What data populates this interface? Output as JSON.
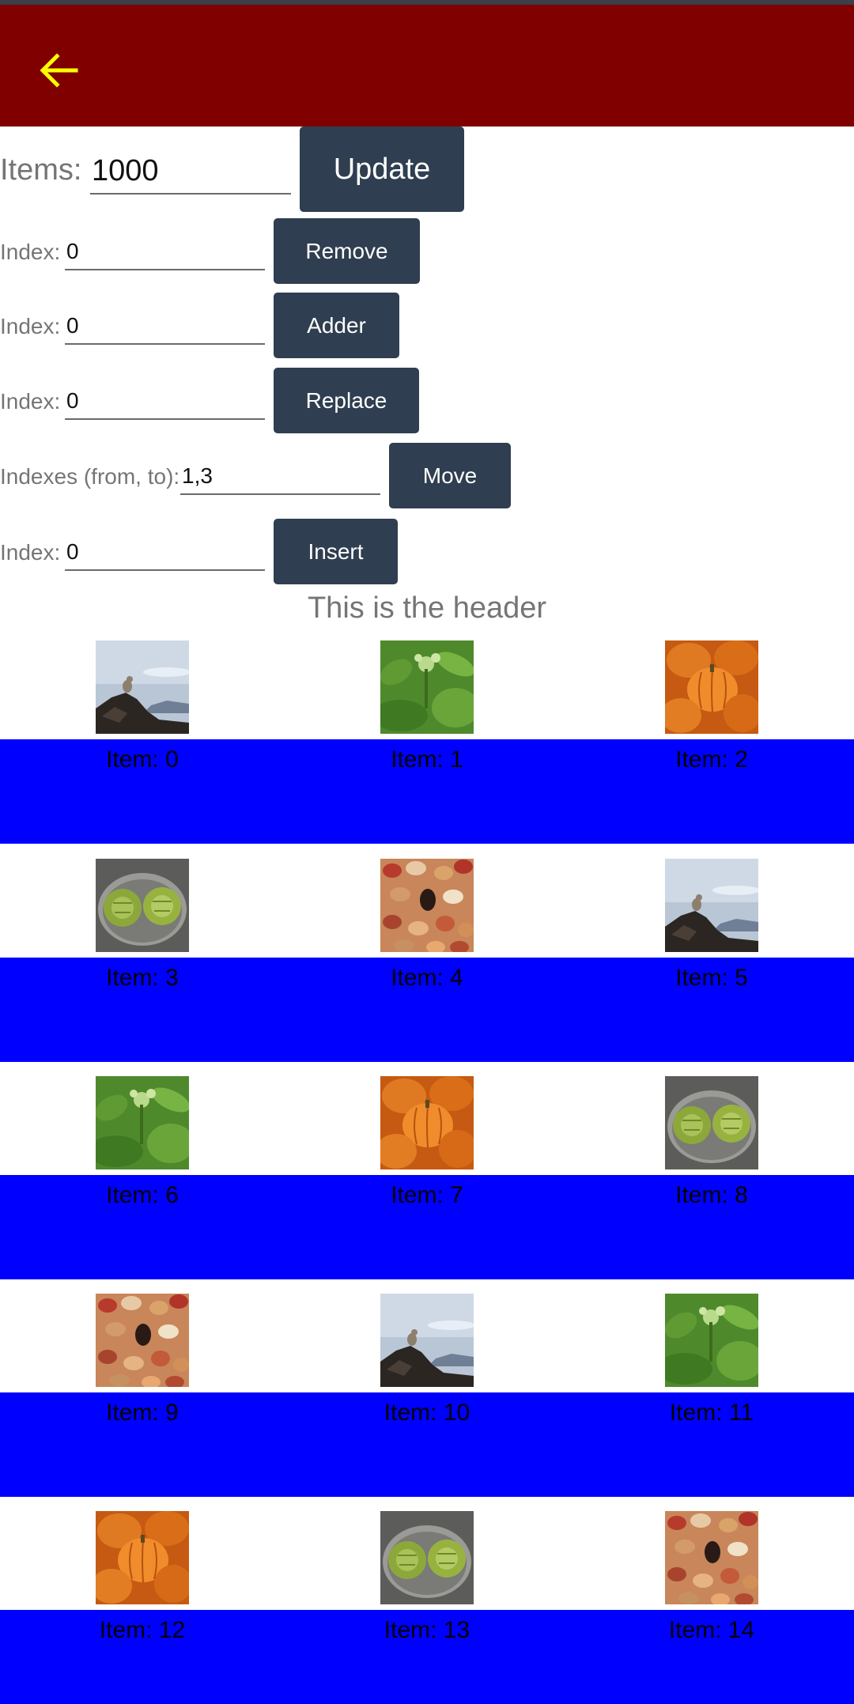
{
  "colors": {
    "appbar": "#800000",
    "band": "#0000ff",
    "button": "#2f3e50",
    "back_icon": "#ffff00"
  },
  "appbar": {
    "back_icon": "arrow-left-icon"
  },
  "controls": {
    "items": {
      "label": "Items:",
      "value": "1000",
      "button": "Update"
    },
    "remove": {
      "label": "Index:",
      "value": "0",
      "button": "Remove"
    },
    "adder": {
      "label": "Index:",
      "value": "0",
      "button": "Adder"
    },
    "replace": {
      "label": "Index:",
      "value": "0",
      "button": "Replace"
    },
    "move": {
      "label": "Indexes (from, to):",
      "value": "1,3",
      "button": "Move"
    },
    "insert": {
      "label": "Index:",
      "value": "0",
      "button": "Insert"
    }
  },
  "header": "This is the header",
  "grid": {
    "rows": [
      [
        {
          "label": "Item: 0",
          "image": "mountain"
        },
        {
          "label": "Item: 1",
          "image": "plant"
        },
        {
          "label": "Item: 2",
          "image": "pumpkins"
        }
      ],
      [
        {
          "label": "Item: 3",
          "image": "artichokes"
        },
        {
          "label": "Item: 4",
          "image": "beans"
        },
        {
          "label": "Item: 5",
          "image": "mountain"
        }
      ],
      [
        {
          "label": "Item: 6",
          "image": "plant"
        },
        {
          "label": "Item: 7",
          "image": "pumpkins"
        },
        {
          "label": "Item: 8",
          "image": "artichokes"
        }
      ],
      [
        {
          "label": "Item: 9",
          "image": "beans"
        },
        {
          "label": "Item: 10",
          "image": "mountain"
        },
        {
          "label": "Item: 11",
          "image": "plant"
        }
      ],
      [
        {
          "label": "Item: 12",
          "image": "pumpkins"
        },
        {
          "label": "Item: 13",
          "image": "artichokes"
        },
        {
          "label": "Item: 14",
          "image": "beans"
        }
      ]
    ]
  }
}
